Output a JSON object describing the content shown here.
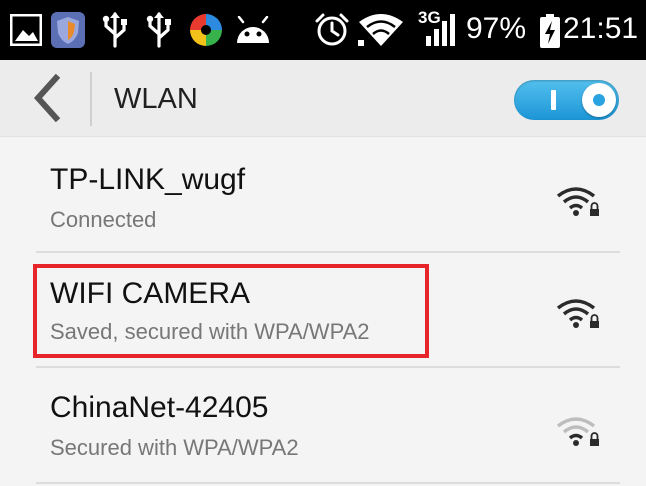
{
  "status_bar": {
    "network_type": "3G",
    "battery": "97%",
    "time": "21:51",
    "icons": [
      "gallery-icon",
      "shield-app-icon",
      "usb-icon",
      "usb-icon",
      "colorful-app-icon",
      "android-icon",
      "alarm-icon",
      "wifi-status-icon",
      "signal-bars-icon",
      "battery-charging-icon"
    ]
  },
  "action_bar": {
    "back_icon": "chevron-left-icon",
    "title": "WLAN",
    "wlan_enabled": true,
    "toggle_color": "#2aa3e0"
  },
  "networks": [
    {
      "ssid": "TP-LINK_wugf",
      "status": "Connected",
      "signal": "strong",
      "secured": true
    },
    {
      "ssid": "WIFI CAMERA",
      "status": "Saved, secured with WPA/WPA2",
      "signal": "strong",
      "secured": true
    },
    {
      "ssid": "ChinaNet-42405",
      "status": "Secured with WPA/WPA2",
      "signal": "weak",
      "secured": true
    }
  ],
  "highlight": {
    "network": "WIFI CAMERA",
    "color": "#e8242b"
  }
}
